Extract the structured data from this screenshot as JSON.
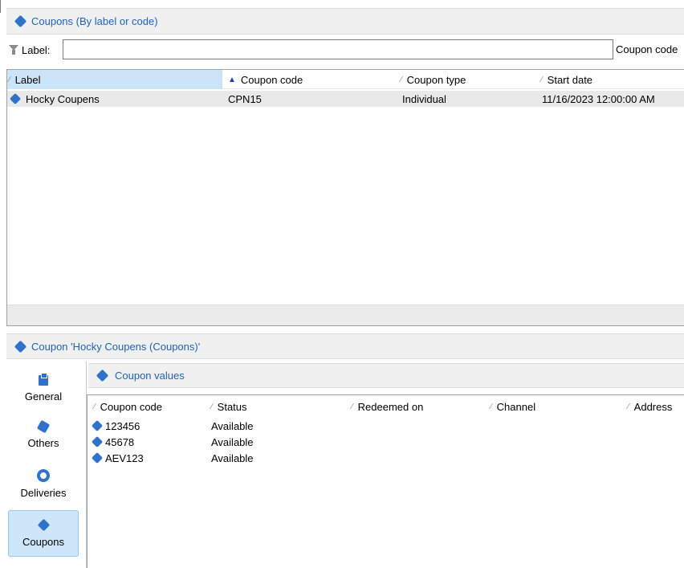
{
  "top_panel": {
    "title": "Coupons (By label or code)",
    "filter": {
      "label": "Label:",
      "value": "",
      "second_label": "Coupon code"
    },
    "columns": [
      "Label",
      "Coupon code",
      "Coupon type",
      "Start date"
    ],
    "sorted_column": "Coupon code",
    "selected_column": "Label",
    "rows": [
      {
        "label": "Hocky Coupens",
        "code": "CPN15",
        "type": "Individual",
        "start": "11/16/2023 12:00:00 AM"
      }
    ]
  },
  "detail": {
    "title": "Coupon 'Hocky Coupens (Coupons)'",
    "nav": [
      {
        "label": "General",
        "icon": "clipboard-icon",
        "active": false
      },
      {
        "label": "Others",
        "icon": "cube-icon",
        "active": false
      },
      {
        "label": "Deliveries",
        "icon": "ring-icon",
        "active": false
      },
      {
        "label": "Coupons",
        "icon": "coupon-icon",
        "active": true
      }
    ],
    "values_panel": {
      "title": "Coupon values",
      "columns": [
        "Coupon code",
        "Status",
        "Redeemed on",
        "Channel",
        "Address"
      ],
      "rows": [
        {
          "code": "123456",
          "status": "Available"
        },
        {
          "code": "45678",
          "status": "Available"
        },
        {
          "code": "AEV123",
          "status": "Available"
        }
      ]
    }
  },
  "colors": {
    "accent": "#2e73c9",
    "title_text": "#1f63b5",
    "active_nav_bg": "#cde6fa",
    "selected_header_bg": "#cce4f7"
  }
}
